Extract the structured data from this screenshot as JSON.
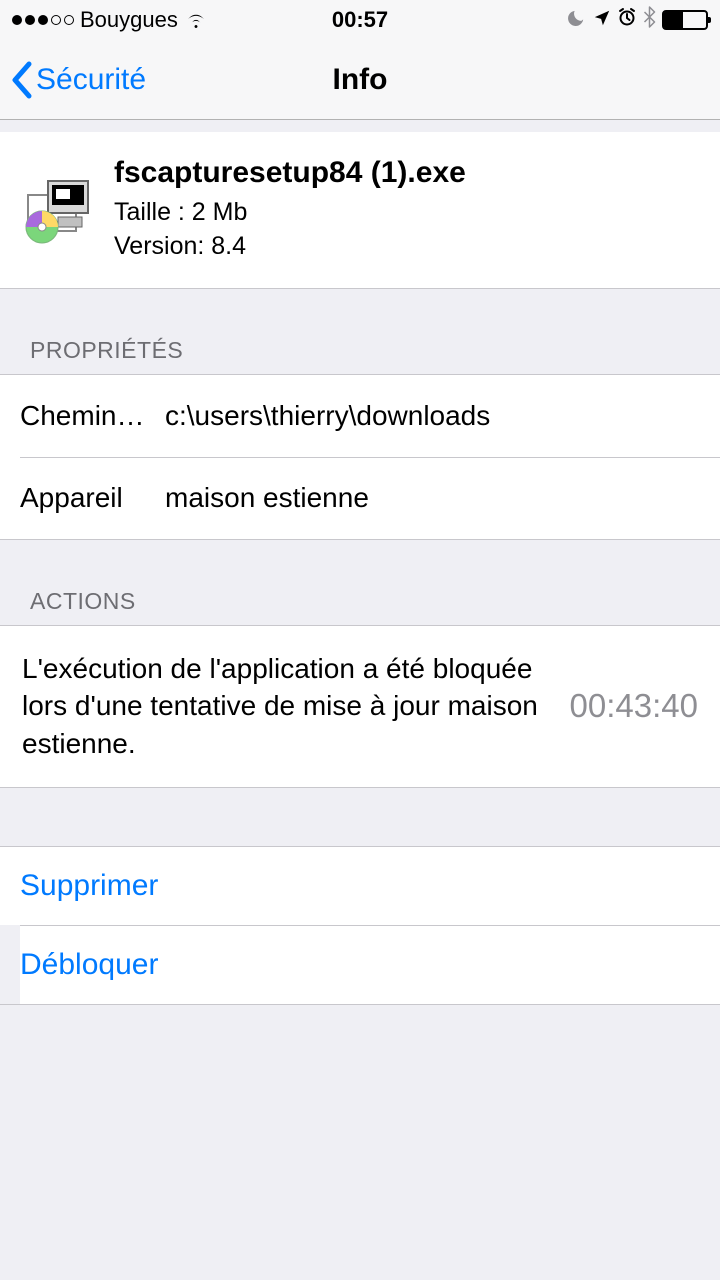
{
  "status": {
    "carrier": "Bouygues",
    "time": "00:57"
  },
  "nav": {
    "back_label": "Sécurité",
    "title": "Info"
  },
  "file": {
    "name": "fscapturesetup84 (1).exe",
    "size_label": "Taille : 2 Mb",
    "version_label": "Version: 8.4"
  },
  "sections": {
    "properties_header": "PROPRIÉTÉS",
    "actions_header": "ACTIONS"
  },
  "properties": {
    "path_label": "Chemin…",
    "path_value": "c:\\users\\thierry\\downloads",
    "device_label": "Appareil",
    "device_value": "maison estienne"
  },
  "action_event": {
    "text": "L'exécution de l'application a été bloquée lors d'une tentative de mise à jour maison estienne.",
    "time": "00:43:40"
  },
  "buttons": {
    "delete": "Supprimer",
    "unblock": "Débloquer"
  }
}
